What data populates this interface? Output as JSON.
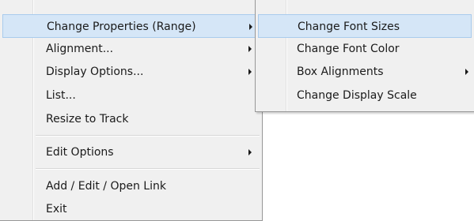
{
  "context_menu": {
    "items": [
      {
        "label": "Change Properties (Range)",
        "has_submenu": true,
        "highlighted": true
      },
      {
        "label": "Alignment...",
        "has_submenu": true
      },
      {
        "label": "Display Options...",
        "has_submenu": true
      },
      {
        "label": "List...",
        "has_submenu": false
      },
      {
        "label": "Resize to Track",
        "has_submenu": false
      },
      {
        "label": "Edit Options",
        "has_submenu": true
      },
      {
        "label": "Add / Edit / Open Link",
        "has_submenu": false
      },
      {
        "label": "Exit",
        "has_submenu": false
      }
    ]
  },
  "submenu": {
    "items": [
      {
        "label": "Change Font Sizes",
        "highlighted": true
      },
      {
        "label": "Change Font Color"
      },
      {
        "label": "Box Alignments",
        "has_submenu": true
      },
      {
        "label": "Change Display Scale"
      }
    ]
  },
  "colors": {
    "menu_background": "#f0f0f0",
    "highlight_background": "#d5e6f7",
    "highlight_border": "#a9cbed",
    "menu_border": "#979797"
  }
}
